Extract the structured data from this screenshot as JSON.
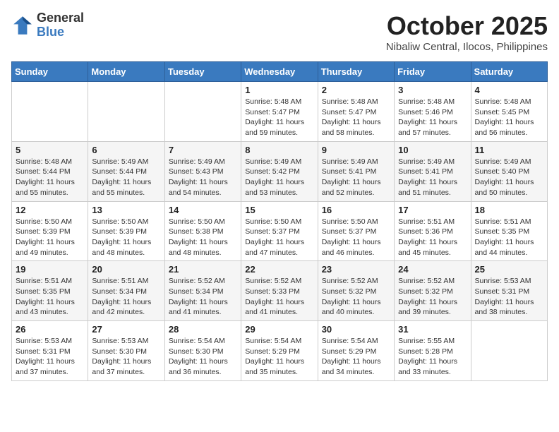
{
  "header": {
    "logo_general": "General",
    "logo_blue": "Blue",
    "month_title": "October 2025",
    "location": "Nibaliw Central, Ilocos, Philippines"
  },
  "weekdays": [
    "Sunday",
    "Monday",
    "Tuesday",
    "Wednesday",
    "Thursday",
    "Friday",
    "Saturday"
  ],
  "weeks": [
    [
      {
        "day": "",
        "info": ""
      },
      {
        "day": "",
        "info": ""
      },
      {
        "day": "",
        "info": ""
      },
      {
        "day": "1",
        "info": "Sunrise: 5:48 AM\nSunset: 5:47 PM\nDaylight: 11 hours\nand 59 minutes."
      },
      {
        "day": "2",
        "info": "Sunrise: 5:48 AM\nSunset: 5:47 PM\nDaylight: 11 hours\nand 58 minutes."
      },
      {
        "day": "3",
        "info": "Sunrise: 5:48 AM\nSunset: 5:46 PM\nDaylight: 11 hours\nand 57 minutes."
      },
      {
        "day": "4",
        "info": "Sunrise: 5:48 AM\nSunset: 5:45 PM\nDaylight: 11 hours\nand 56 minutes."
      }
    ],
    [
      {
        "day": "5",
        "info": "Sunrise: 5:48 AM\nSunset: 5:44 PM\nDaylight: 11 hours\nand 55 minutes."
      },
      {
        "day": "6",
        "info": "Sunrise: 5:49 AM\nSunset: 5:44 PM\nDaylight: 11 hours\nand 55 minutes."
      },
      {
        "day": "7",
        "info": "Sunrise: 5:49 AM\nSunset: 5:43 PM\nDaylight: 11 hours\nand 54 minutes."
      },
      {
        "day": "8",
        "info": "Sunrise: 5:49 AM\nSunset: 5:42 PM\nDaylight: 11 hours\nand 53 minutes."
      },
      {
        "day": "9",
        "info": "Sunrise: 5:49 AM\nSunset: 5:41 PM\nDaylight: 11 hours\nand 52 minutes."
      },
      {
        "day": "10",
        "info": "Sunrise: 5:49 AM\nSunset: 5:41 PM\nDaylight: 11 hours\nand 51 minutes."
      },
      {
        "day": "11",
        "info": "Sunrise: 5:49 AM\nSunset: 5:40 PM\nDaylight: 11 hours\nand 50 minutes."
      }
    ],
    [
      {
        "day": "12",
        "info": "Sunrise: 5:50 AM\nSunset: 5:39 PM\nDaylight: 11 hours\nand 49 minutes."
      },
      {
        "day": "13",
        "info": "Sunrise: 5:50 AM\nSunset: 5:39 PM\nDaylight: 11 hours\nand 48 minutes."
      },
      {
        "day": "14",
        "info": "Sunrise: 5:50 AM\nSunset: 5:38 PM\nDaylight: 11 hours\nand 48 minutes."
      },
      {
        "day": "15",
        "info": "Sunrise: 5:50 AM\nSunset: 5:37 PM\nDaylight: 11 hours\nand 47 minutes."
      },
      {
        "day": "16",
        "info": "Sunrise: 5:50 AM\nSunset: 5:37 PM\nDaylight: 11 hours\nand 46 minutes."
      },
      {
        "day": "17",
        "info": "Sunrise: 5:51 AM\nSunset: 5:36 PM\nDaylight: 11 hours\nand 45 minutes."
      },
      {
        "day": "18",
        "info": "Sunrise: 5:51 AM\nSunset: 5:35 PM\nDaylight: 11 hours\nand 44 minutes."
      }
    ],
    [
      {
        "day": "19",
        "info": "Sunrise: 5:51 AM\nSunset: 5:35 PM\nDaylight: 11 hours\nand 43 minutes."
      },
      {
        "day": "20",
        "info": "Sunrise: 5:51 AM\nSunset: 5:34 PM\nDaylight: 11 hours\nand 42 minutes."
      },
      {
        "day": "21",
        "info": "Sunrise: 5:52 AM\nSunset: 5:34 PM\nDaylight: 11 hours\nand 41 minutes."
      },
      {
        "day": "22",
        "info": "Sunrise: 5:52 AM\nSunset: 5:33 PM\nDaylight: 11 hours\nand 41 minutes."
      },
      {
        "day": "23",
        "info": "Sunrise: 5:52 AM\nSunset: 5:32 PM\nDaylight: 11 hours\nand 40 minutes."
      },
      {
        "day": "24",
        "info": "Sunrise: 5:52 AM\nSunset: 5:32 PM\nDaylight: 11 hours\nand 39 minutes."
      },
      {
        "day": "25",
        "info": "Sunrise: 5:53 AM\nSunset: 5:31 PM\nDaylight: 11 hours\nand 38 minutes."
      }
    ],
    [
      {
        "day": "26",
        "info": "Sunrise: 5:53 AM\nSunset: 5:31 PM\nDaylight: 11 hours\nand 37 minutes."
      },
      {
        "day": "27",
        "info": "Sunrise: 5:53 AM\nSunset: 5:30 PM\nDaylight: 11 hours\nand 37 minutes."
      },
      {
        "day": "28",
        "info": "Sunrise: 5:54 AM\nSunset: 5:30 PM\nDaylight: 11 hours\nand 36 minutes."
      },
      {
        "day": "29",
        "info": "Sunrise: 5:54 AM\nSunset: 5:29 PM\nDaylight: 11 hours\nand 35 minutes."
      },
      {
        "day": "30",
        "info": "Sunrise: 5:54 AM\nSunset: 5:29 PM\nDaylight: 11 hours\nand 34 minutes."
      },
      {
        "day": "31",
        "info": "Sunrise: 5:55 AM\nSunset: 5:28 PM\nDaylight: 11 hours\nand 33 minutes."
      },
      {
        "day": "",
        "info": ""
      }
    ]
  ]
}
